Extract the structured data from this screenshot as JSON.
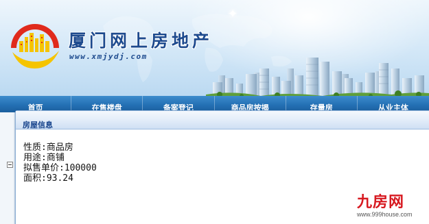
{
  "header": {
    "site_title": "厦门网上房地产",
    "site_url": "www.xmjydj.com"
  },
  "nav": {
    "items": [
      {
        "label": "首页"
      },
      {
        "label": "在售楼盘"
      },
      {
        "label": "备案登记"
      },
      {
        "label": "商品房按揭"
      },
      {
        "label": "存量房"
      },
      {
        "label": "从业主体"
      }
    ]
  },
  "dialog": {
    "title": "房屋信息",
    "property_type": "性质:商品房",
    "usage": "用途:商铺",
    "unit_price": "拟售单价:100000",
    "area": "面积:93.24"
  },
  "watermark": {
    "mark": "九房网",
    "url": "www.999house.com"
  },
  "colors": {
    "brand_blue": "#1d4a8e",
    "nav_blue": "#2470b4",
    "logo_red": "#e02a1c",
    "logo_yellow": "#f5c400",
    "watermark_red": "#d71920"
  },
  "icons": {
    "logo": "city-skyline-sun-logo",
    "tree_toggle": "collapse-box-icon"
  }
}
